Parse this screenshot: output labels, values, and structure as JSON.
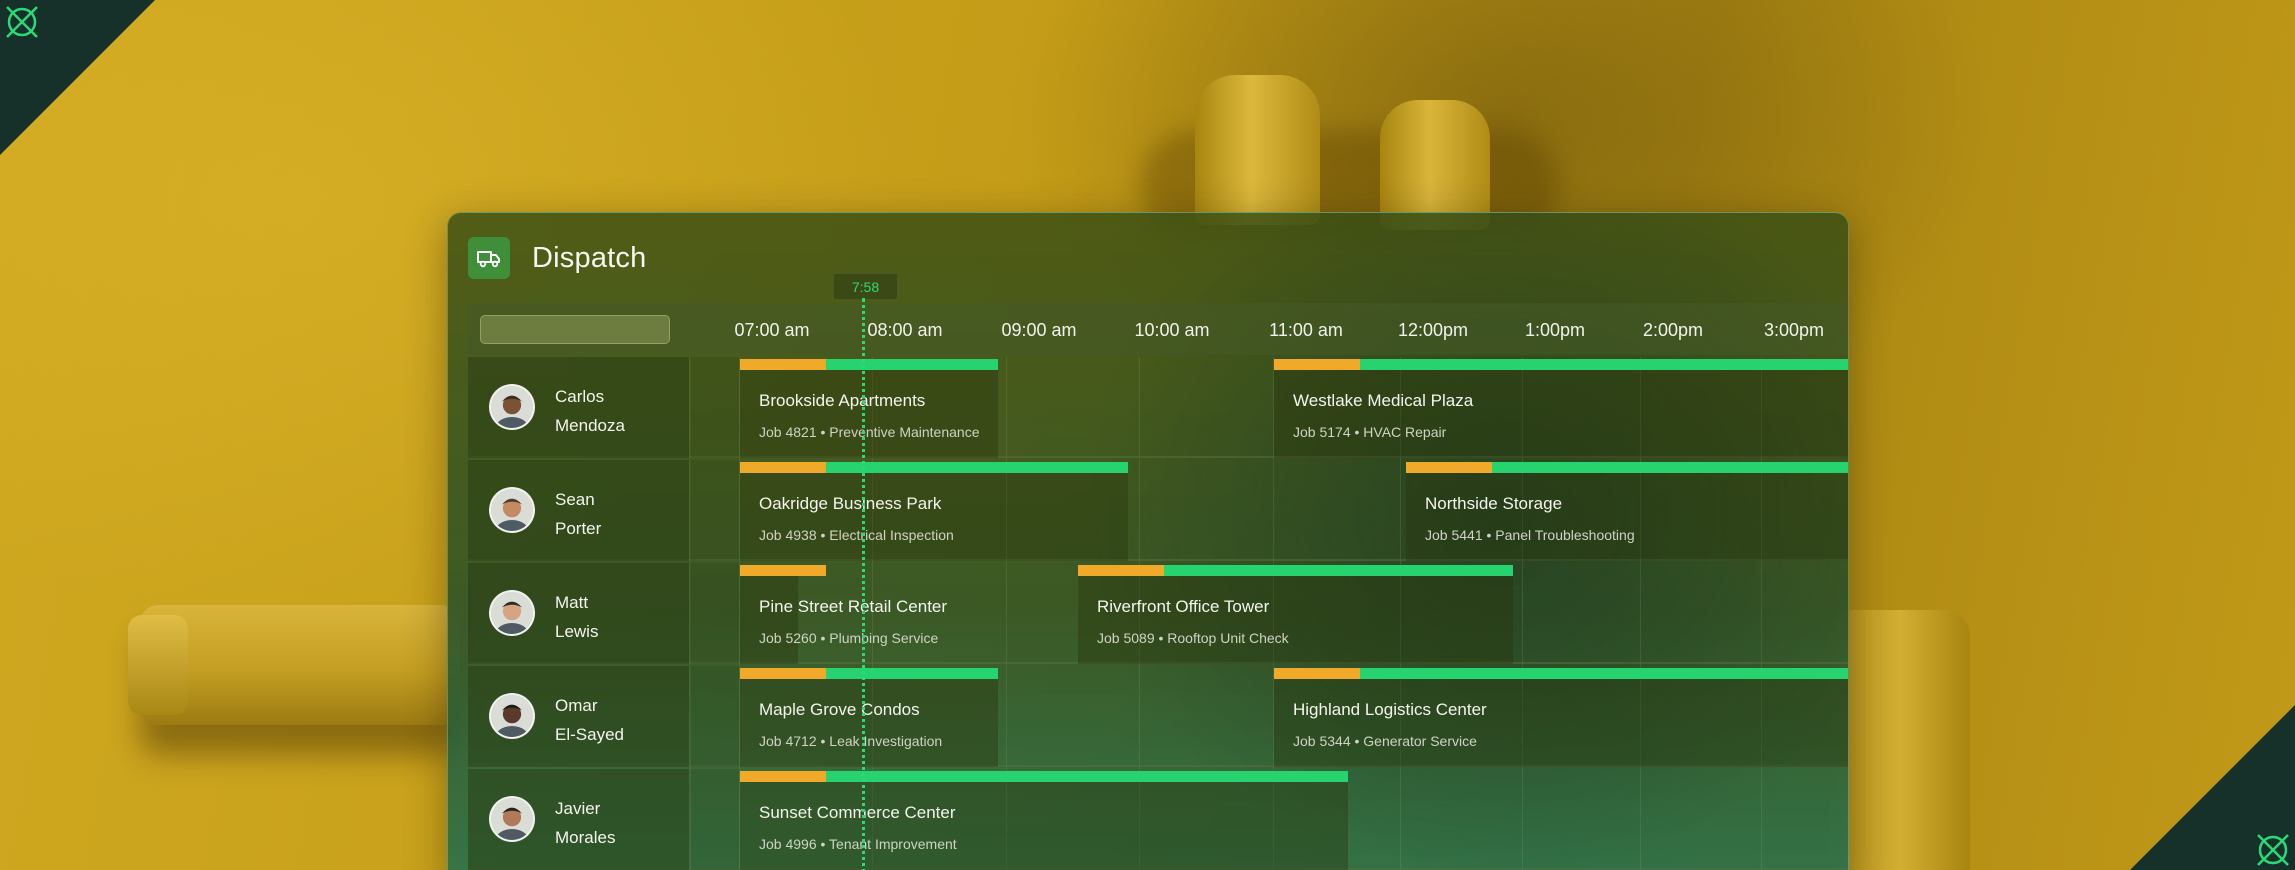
{
  "app": {
    "title": "Dispatch",
    "logo_icon": "truck-icon",
    "current_time": "7:58"
  },
  "colors": {
    "travel": "#f0a928",
    "work": "#26d36e",
    "now_marker": "#2bd977"
  },
  "search": {
    "placeholder": ""
  },
  "timeline": {
    "hours": [
      "07:00 am",
      "08:00 am",
      "09:00 am",
      "10:00 am",
      "11:00 am",
      "12:00pm",
      "1:00pm",
      "2:00pm",
      "3:00pm"
    ]
  },
  "technicians": [
    {
      "first": "Carlos",
      "last": "Mendoza",
      "jobs": [
        {
          "title": "Brookside Apartments",
          "subtitle": "Job 4821 • Preventive Maintenance"
        },
        {
          "title": "Westlake Medical Plaza",
          "subtitle": " Job 5174 • HVAC Repair"
        }
      ]
    },
    {
      "first": "Sean",
      "last": "Porter",
      "jobs": [
        {
          "title": "Oakridge Business Park",
          "subtitle": "Job 4938 • Electrical Inspection"
        },
        {
          "title": "Northside Storage",
          "subtitle": "Job 5441 • Panel Troubleshooting"
        }
      ]
    },
    {
      "first": "Matt",
      "last": "Lewis",
      "jobs": [
        {
          "title": "Pine Street Retail Center",
          "subtitle": "Job 5260 • Plumbing Service"
        },
        {
          "title": "Riverfront Office Tower",
          "subtitle": "Job 5089 • Rooftop Unit Check"
        }
      ]
    },
    {
      "first": "Omar",
      "last": "El-Sayed",
      "jobs": [
        {
          "title": "Maple Grove Condos",
          "subtitle": "Job 4712 • Leak Investigation"
        },
        {
          "title": "Highland Logistics Center",
          "subtitle": "Job 5344 • Generator Service"
        }
      ]
    },
    {
      "first": "Javier",
      "last": "Morales",
      "jobs": [
        {
          "title": "Sunset Commerce Center",
          "subtitle": "Job 4996 • Tenant Improvement"
        }
      ]
    }
  ]
}
